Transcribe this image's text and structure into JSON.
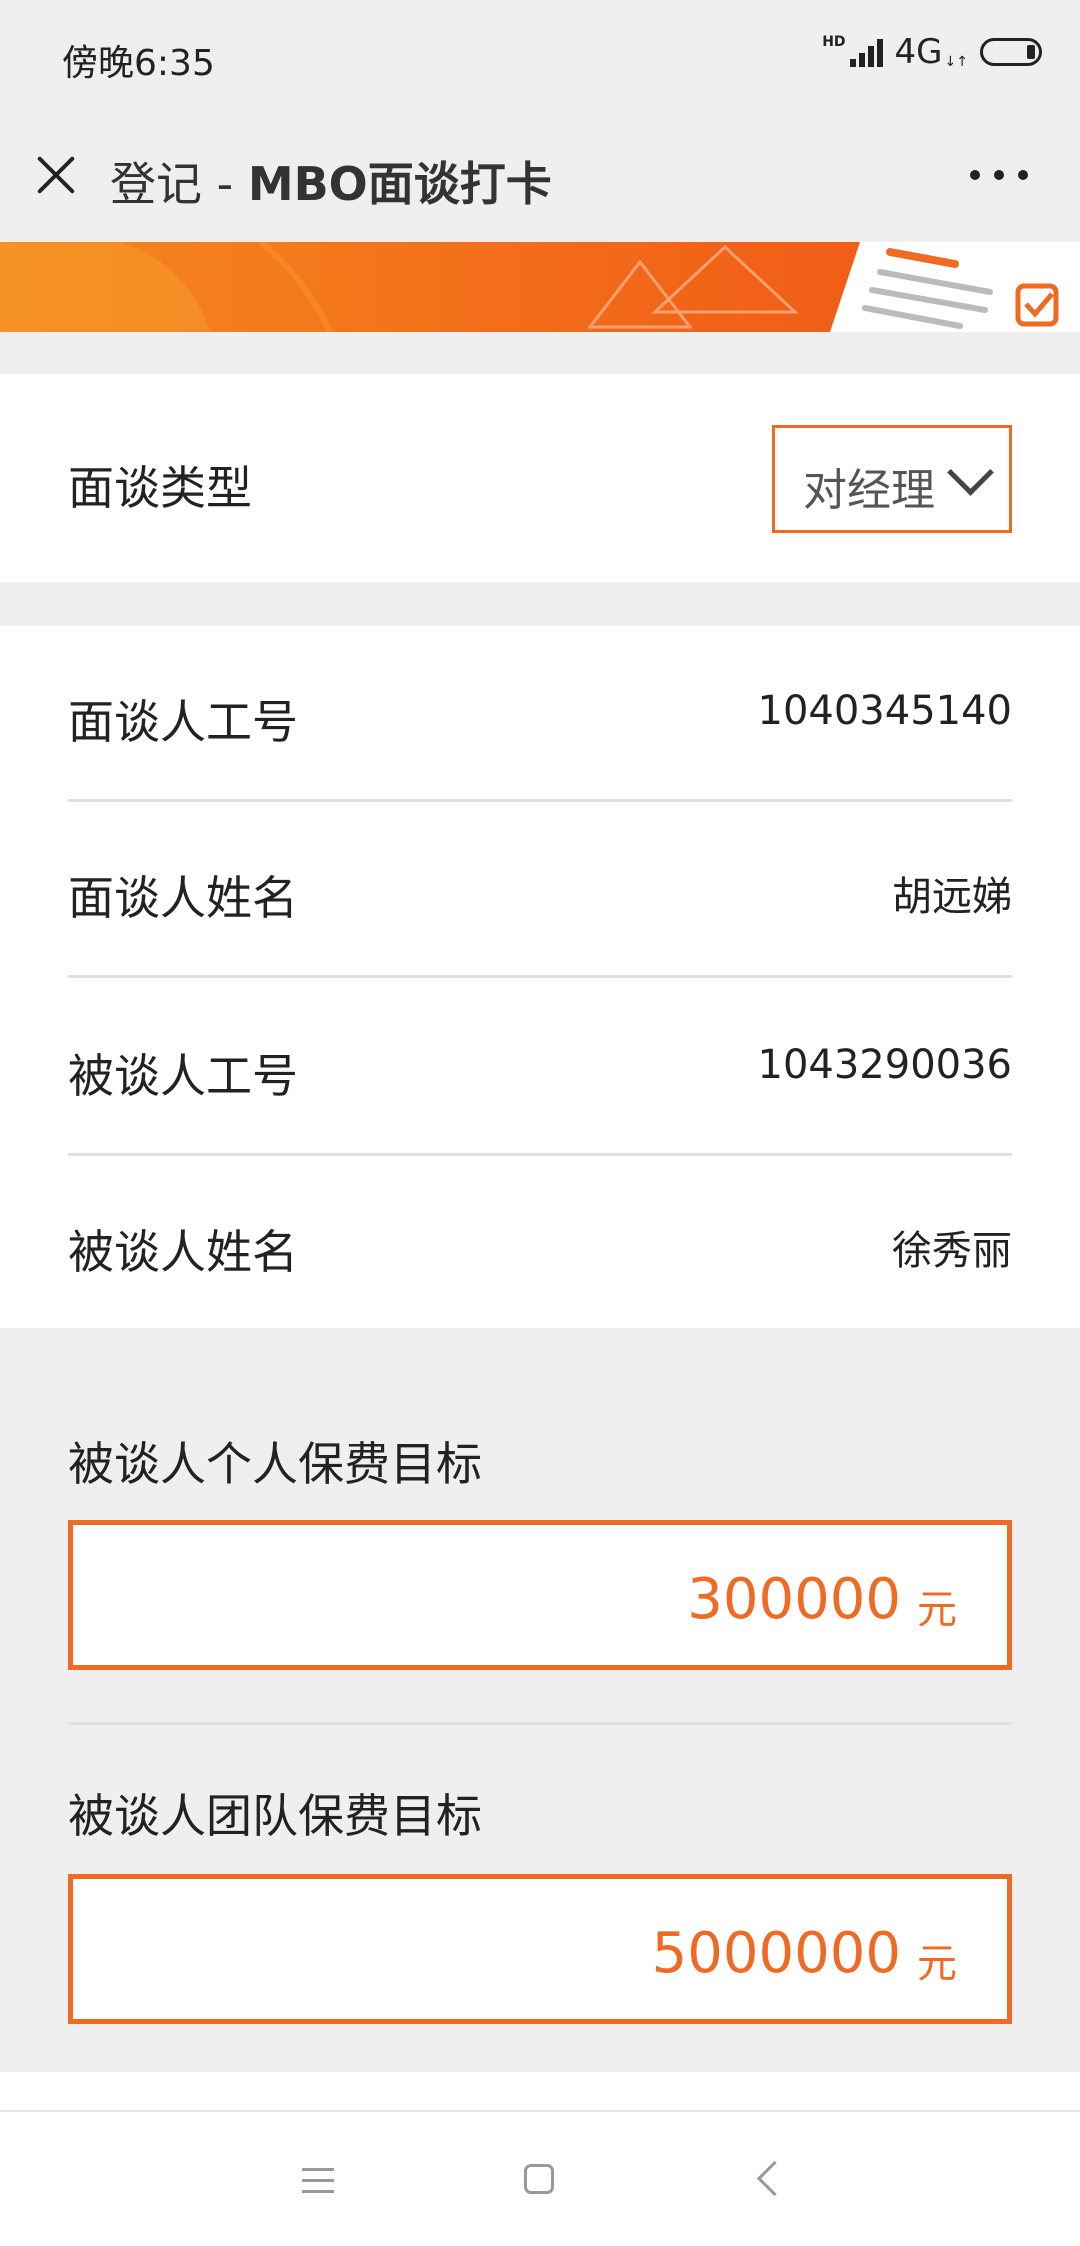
{
  "status": {
    "time": "傍晚6:35",
    "hd": "HD",
    "network": "4G",
    "arrows": "↓↑"
  },
  "nav": {
    "title_prefix": "登记 - ",
    "title_main": "MBO面谈打卡"
  },
  "interview_type": {
    "label": "面谈类型",
    "selected": "对经理"
  },
  "info": {
    "interviewer_id_label": "面谈人工号",
    "interviewer_id": "1040345140",
    "interviewer_name_label": "面谈人姓名",
    "interviewer_name": "胡远娣",
    "interviewee_id_label": "被谈人工号",
    "interviewee_id": "1043290036",
    "interviewee_name_label": "被谈人姓名",
    "interviewee_name": "徐秀丽"
  },
  "goals": {
    "personal_label": "被谈人个人保费目标",
    "personal_value": "300000",
    "team_label": "被谈人团队保费目标",
    "team_value": "5000000",
    "unit": "元"
  },
  "colors": {
    "accent": "#ef6a23",
    "background": "#efefef"
  },
  "icons": [
    "close-icon",
    "more-icon",
    "chevron-down-icon",
    "menu-icon",
    "home-icon",
    "back-icon"
  ]
}
